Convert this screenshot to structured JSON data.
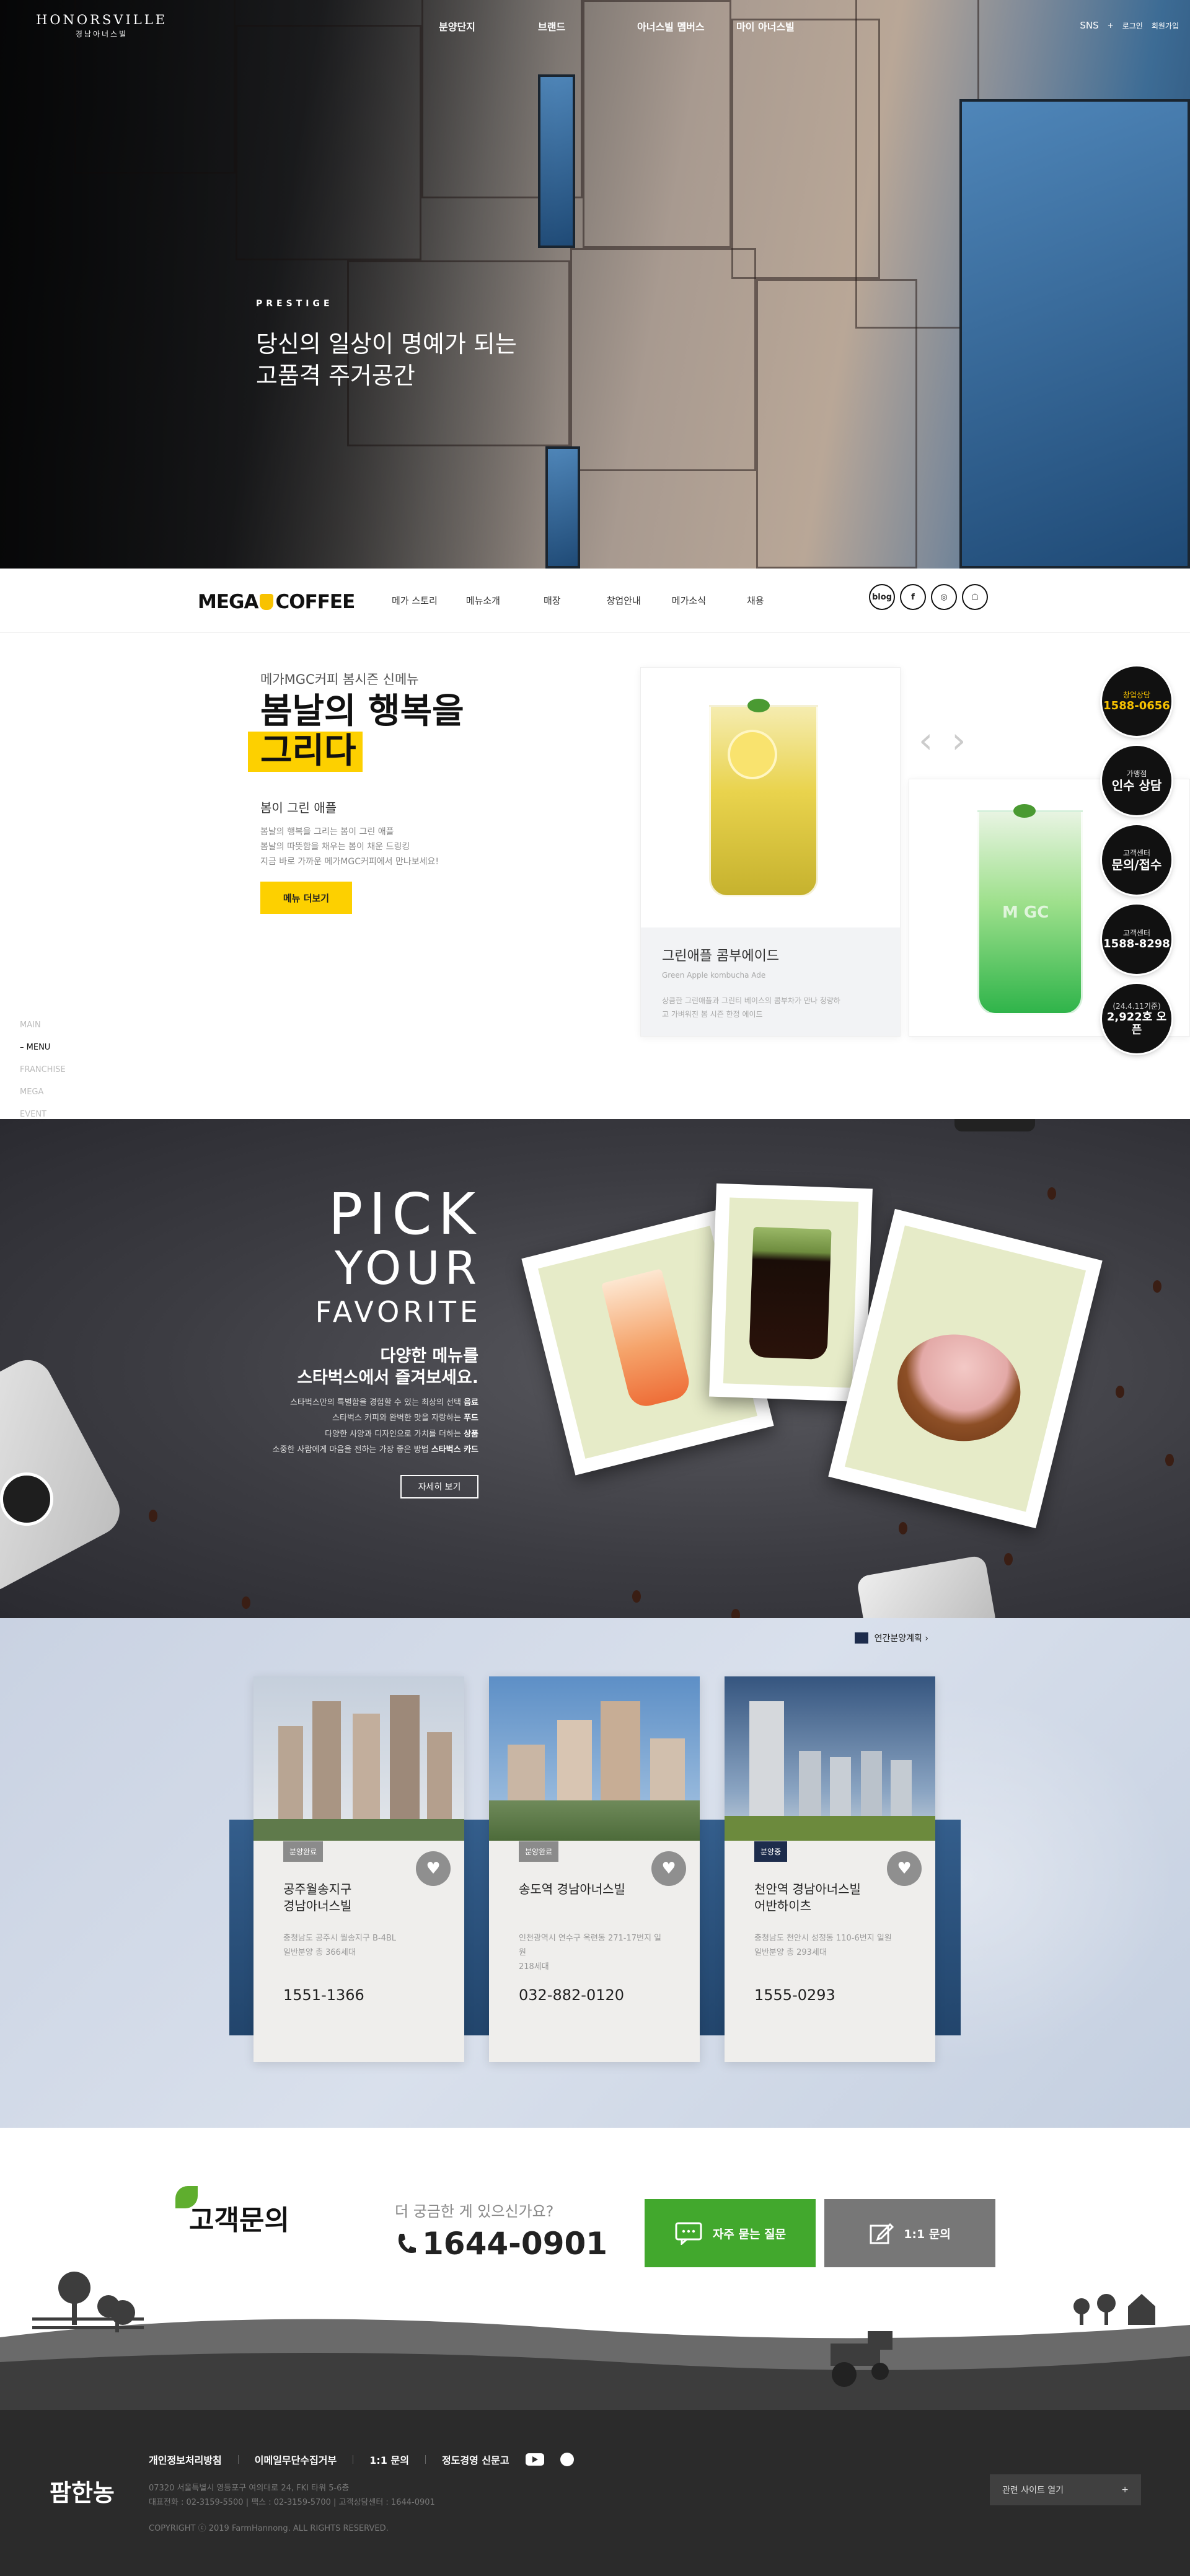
{
  "hero": {
    "logo_en": "HONORSVILLE",
    "logo_ko": "경남아너스빌",
    "nav": [
      "분양단지",
      "브랜드",
      "아너스빌 멤버스",
      "마이 아너스빌"
    ],
    "util": {
      "sns": "SNS",
      "sns_plus": "+",
      "login": "로그인",
      "join": "회원가입"
    },
    "eyebrow": "PRESTIGE",
    "headline_1": "당신의 일상이 명예가 되는",
    "headline_2": "고품격 주거공간"
  },
  "mega": {
    "logo_a": "MEGA",
    "logo_b": "COFFEE",
    "nav": [
      "메가 스토리",
      "메뉴소개",
      "매장",
      "창업안내",
      "메가소식",
      "채용"
    ],
    "sns": [
      "blog",
      "f",
      "◎",
      "☖"
    ],
    "sub": "메가MGC커피 봄시즌 신메뉴",
    "title_1": "봄날의 행복을",
    "title_2": "그리다",
    "menu_name": "봄이 그린 애플",
    "desc": [
      "봄날의 행복을 그리는 봄이 그린 애플",
      "봄날의 따뜻함을 채우는 봄이 채운 드링킹",
      "지금 바로 가까운 메가MGC커피에서 만나보세요!"
    ],
    "button": "메뉴 더보기",
    "card": {
      "name": "그린애플 콤부에이드",
      "en": "Green Apple kombucha Ade",
      "desc_1": "상큼한 그린애플과 그린티 베이스의 콤부차가 만나 청량하",
      "desc_2": "고 가벼워진 봄 시즌 한정 에이드"
    },
    "cup_label": "M GC",
    "side_nav": [
      "MAIN",
      "MENU",
      "FRANCHISE",
      "MEGA",
      "EVENT"
    ],
    "side_active": "MENU",
    "circles": [
      {
        "small": "창업상담",
        "big": "1588-0656",
        "yellow": true
      },
      {
        "small": "가맹점",
        "big": "인수 상담",
        "yellow": false
      },
      {
        "small": "고객센터",
        "big": "문의/접수",
        "yellow": false
      },
      {
        "small": "고객센터",
        "big": "1588-8298",
        "yellow": false
      },
      {
        "small": "(24.4.11기준)",
        "big": "2,922호 오픈",
        "yellow": false
      }
    ]
  },
  "sbux": {
    "pick": "PICK",
    "your": "YOUR",
    "favorite": "FAVORITE",
    "heading_1": "다양한 메뉴를",
    "heading_2": "스타벅스에서 즐겨보세요.",
    "line_1": "스타벅스만의 특별함을 경험할 수 있는 최상의 선택",
    "line_1b": "음료",
    "line_2": "스타벅스 커피와 완벽한 맛을 자랑하는",
    "line_2b": "푸드",
    "line_3": "다양한 사양과 디자인으로 가치를 더하는",
    "line_3b": "상품",
    "line_4": "소중한 사람에게 마음을 전하는 가장 좋은 방법",
    "line_4b": "스타벅스 카드",
    "button": "자세히 보기"
  },
  "apt": {
    "plan_link": "연간분양계획 ›",
    "cards": [
      {
        "badge": "분양완료",
        "name_1": "공주월송지구",
        "name_2": "경남아너스빌",
        "addr_1": "충청남도 공주시 월송지구 B-4BL",
        "addr_2": "일반분양 총 366세대",
        "tel": "1551-1366",
        "badge_color": "#8b8b8b"
      },
      {
        "badge": "분양완료",
        "name_1": "송도역 경남아너스빌",
        "name_2": "",
        "addr_1": "인천광역시 연수구 옥련동 271-17번지 일",
        "addr_2": "원",
        "addr_3": "218세대",
        "tel": "032-882-0120",
        "badge_color": "#8b8b8b"
      },
      {
        "badge": "분양중",
        "name_1": "천안역 경남아너스빌",
        "name_2": "어반하이츠",
        "addr_1": "충청남도 천안시 성정동 110-6번지 일원",
        "addr_2": "일반분양 총 293세대",
        "tel": "1555-0293",
        "badge_color": "#1d2c4c"
      }
    ],
    "heart": "♥"
  },
  "farm": {
    "cs_title": "고객문의",
    "cs_question": "더 궁금한 게 있으신가요?",
    "cs_tel": "1644-0901",
    "faq_button": "자주 묻는 질문",
    "qna_button": "1:1 문의",
    "footer_logo": "팜한농",
    "footer_links": [
      "개인정보처리방침",
      "이메일무단수집거부",
      "1:1 문의",
      "정도경영 신문고"
    ],
    "address": "07320 서울특별시 영등포구 여의대로 24, FKI 타워 5-6층",
    "phones": "대표전화 : 02-3159-5500   |   팩스 : 02-3159-5700   |   고객상담센터 : 1644-0901",
    "copyright": "COPYRIGHT ⓒ 2019 FarmHannong. ALL RIGHTS RESERVED.",
    "family_site": "관련 사이트 열기",
    "family_plus": "+"
  },
  "colors": {
    "mega_yellow": "#fdd000",
    "farm_green": "#42a82d",
    "apt_navy": "#1d2c4c"
  }
}
